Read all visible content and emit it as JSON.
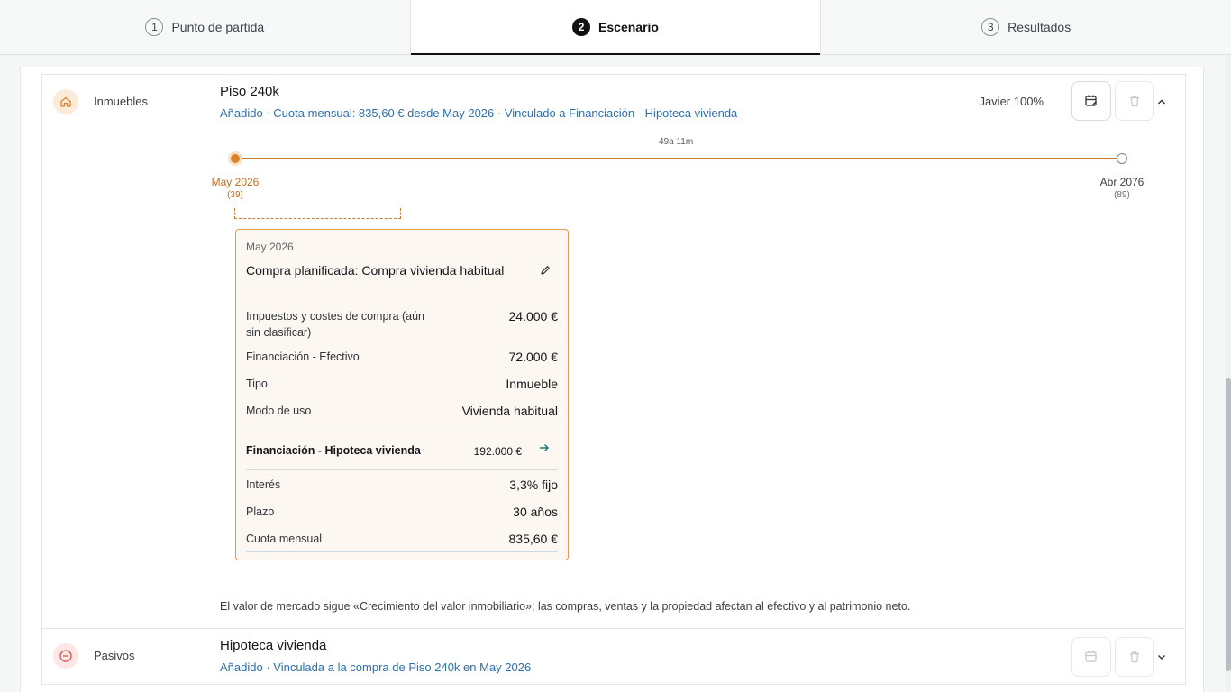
{
  "stepper": {
    "steps": [
      {
        "num": "1",
        "label": "Punto de partida"
      },
      {
        "num": "2",
        "label": "Escenario"
      },
      {
        "num": "3",
        "label": "Resultados"
      }
    ]
  },
  "inmuebles": {
    "category": "Inmuebles",
    "title": "Piso 240k",
    "subtitle": "Añadido · Cuota mensual: 835,60 € desde May 2026 · Vinculado a Financiación - Hipoteca vivienda",
    "owner": "Javier 100%",
    "timeline": {
      "duration": "49a 11m",
      "start_date": "May 2026",
      "start_age": "(39)",
      "end_date": "Abr 2076",
      "end_age": "(89)"
    },
    "event": {
      "date": "May 2026",
      "title": "Compra planificada: Compra vivienda habitual",
      "rows": [
        {
          "label": "Impuestos y costes de compra (aún sin clasificar)",
          "value": "24.000 €"
        },
        {
          "label": "Financiación - Efectivo",
          "value": "72.000 €"
        },
        {
          "label": "Tipo",
          "value": "Inmueble"
        },
        {
          "label": "Modo de uso",
          "value": "Vivienda habitual"
        }
      ],
      "financing": {
        "label": "Financiación - Hipoteca vivienda",
        "amount": "192.000 €",
        "rows": [
          {
            "label": "Interés",
            "value": "3,3% fijo"
          },
          {
            "label": "Plazo",
            "value": "30 años"
          },
          {
            "label": "Cuota mensual",
            "value": "835,60 €"
          }
        ]
      }
    },
    "note": "El valor de mercado sigue «Crecimiento del valor inmobiliario»; las compras, ventas y la propiedad afectan al efectivo y al patrimonio neto."
  },
  "pasivos": {
    "category": "Pasivos",
    "title": "Hipoteca vivienda",
    "subtitle": "Añadido · Vinculada a la compra de Piso 240k en May 2026"
  },
  "colors": {
    "accent_orange": "#d9822b",
    "link_blue": "#2f6fad",
    "card_bg": "#fcf7f1"
  }
}
